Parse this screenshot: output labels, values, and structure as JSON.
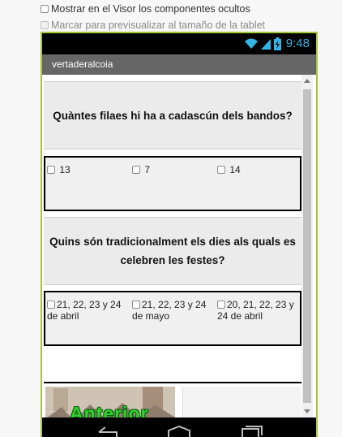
{
  "options": {
    "show_hidden": "Mostrar en el Visor los componentes ocultos",
    "tablet_preview": "Marcar para previsualizar al tamaño de la tablet"
  },
  "status": {
    "time": "9:48"
  },
  "app": {
    "title": "vertaderalcoia"
  },
  "questions": [
    {
      "text": "Quàntes filaes hi ha a cadascún dels bandos?",
      "answers": [
        "13",
        "7",
        "14"
      ]
    },
    {
      "text": "Quins són tradicionalment els dies als quals es celebren les festes?",
      "answers": [
        "21, 22, 23 y 24 de abril",
        "21, 22, 23 y 24 de mayo",
        "20, 21, 22, 23 y 24 de abril"
      ]
    }
  ],
  "image_button": {
    "label": "Anterior"
  },
  "colors": {
    "accent": "#a4c639",
    "status_icons": "#33b5e5"
  }
}
